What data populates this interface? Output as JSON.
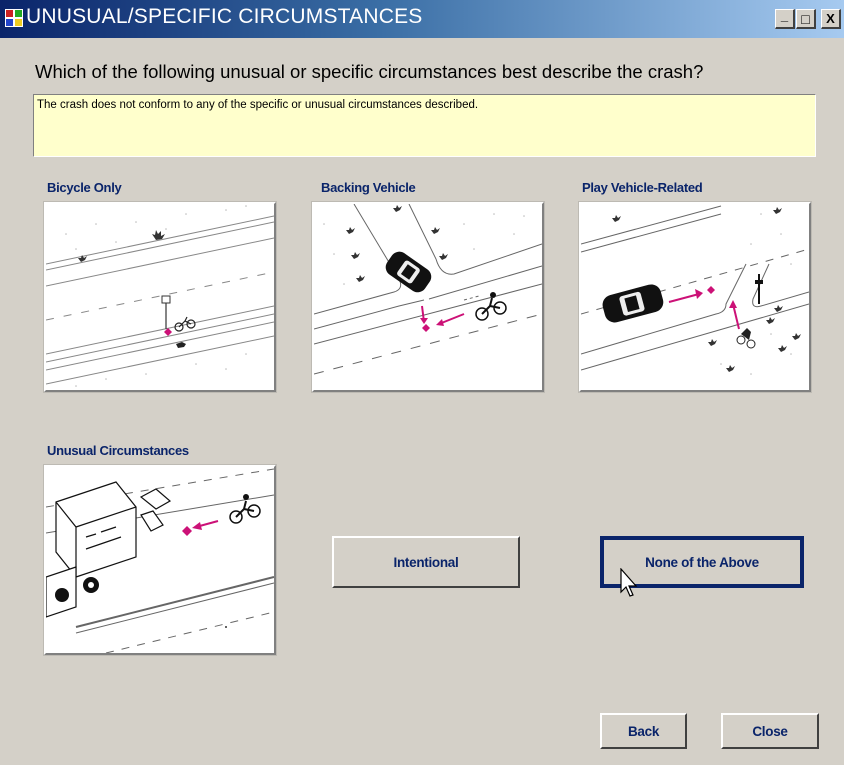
{
  "window": {
    "title": "UNUSUAL/SPECIFIC CIRCUMSTANCES",
    "controls": {
      "minimize": "_",
      "maximize": "□",
      "close": "X"
    }
  },
  "question": "Which of the following unusual or specific circumstances best describe the crash?",
  "description": "The crash does not conform to any of the specific or unusual circumstances described.",
  "options": {
    "bicycle_only": {
      "label": "Bicycle Only"
    },
    "backing_vehicle": {
      "label": "Backing Vehicle"
    },
    "play_vehicle_related": {
      "label": "Play Vehicle-Related"
    },
    "unusual_circumstances": {
      "label": "Unusual Circumstances"
    }
  },
  "buttons": {
    "intentional": "Intentional",
    "none_of_the_above": "None of the Above",
    "back": "Back",
    "close": "Close"
  },
  "colors": {
    "title_gradient_start": "#0a246a",
    "title_gradient_end": "#a6caf0",
    "description_bg": "#ffffcc",
    "label_text": "#0a246a",
    "crash_marker": "#cc1177",
    "window_bg": "#d4d0c8"
  }
}
